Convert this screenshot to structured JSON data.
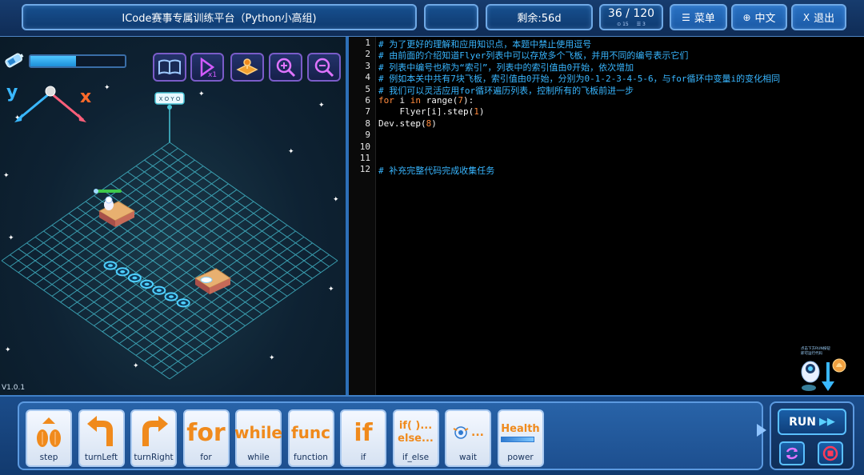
{
  "header": {
    "title": "ICode赛事专属训练平台（Python小高组)",
    "time_remaining": "剩余:56d",
    "progress": "36 / 120",
    "progress_sub_a": "15",
    "progress_sub_b": "3",
    "menu_label": "菜单",
    "lang_label": "中文",
    "exit_label": "退出"
  },
  "game": {
    "health_fraction": 0.48,
    "axis_y_label": "y",
    "axis_x_label": "x",
    "target_label": "X O Y O",
    "version": "V1.0.1",
    "tools": [
      "book-icon",
      "replay-icon",
      "map-icon",
      "zoom-in-icon",
      "zoom-out-icon"
    ]
  },
  "code": {
    "lines": [
      {
        "n": "1",
        "comment": "# 为了更好的理解和应用知识点，本题中禁止使用逗号"
      },
      {
        "n": "2",
        "comment": "# 由前面的介绍知道Flyer列表中可以存放多个飞板，并用不同的编号表示它们"
      },
      {
        "n": "3",
        "comment": "# 列表中编号也称为“索引”，列表中的索引值由0开始，依次增加"
      },
      {
        "n": "4",
        "comment": "# 例如本关中共有7块飞板，索引值由0开始，分别为0-1-2-3-4-5-6，与for循环中变量i的变化相同"
      },
      {
        "n": "5",
        "comment": "# 我们可以灵活应用for循环遍历列表，控制所有的飞板前进一步"
      },
      {
        "n": "6",
        "kw1": "for",
        "t1": " i ",
        "kw2": "in",
        "t2": " range(",
        "num": "7",
        "t3": "):"
      },
      {
        "n": "7",
        "t1": "    Flyer[i].",
        "call": "step(",
        "num": "1",
        "t3": ")"
      },
      {
        "n": "8",
        "t1": "Dev.",
        "call": "step(",
        "num": "8",
        "t3": ")"
      },
      {
        "n": "9"
      },
      {
        "n": "10"
      },
      {
        "n": "11"
      },
      {
        "n": "12",
        "comment": "# 补充完整代码完成收集任务"
      }
    ],
    "hint_text": "点击下方RUN按钮 即可运行代码"
  },
  "palette": {
    "blocks": [
      {
        "name": "step",
        "label": "step"
      },
      {
        "name": "turnleft",
        "label": "turnLeft"
      },
      {
        "name": "turnright",
        "label": "turnRight"
      },
      {
        "name": "for",
        "label": "for",
        "art": "for"
      },
      {
        "name": "while",
        "label": "while",
        "art": "while"
      },
      {
        "name": "function",
        "label": "function",
        "art": "func"
      },
      {
        "name": "if",
        "label": "if",
        "art": "if"
      },
      {
        "name": "if-else",
        "label": "if_else",
        "art": "if( )..."
      },
      {
        "name": "wait",
        "label": "wait",
        "art": "..."
      },
      {
        "name": "power",
        "label": "power",
        "art": "Health"
      }
    ],
    "run_label": "RUN"
  },
  "colors": {
    "accent": "#2a72c4",
    "code_comment": "#38b6ff",
    "code_keyword": "#ff8a3d",
    "block_text": "#f08a1c"
  }
}
